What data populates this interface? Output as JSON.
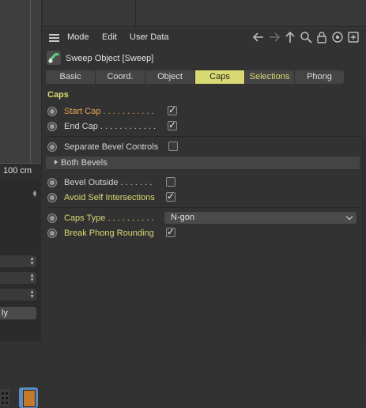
{
  "viewport": {
    "scale_label": "100 cm"
  },
  "left_panel": {
    "apply_button_text": "ly"
  },
  "menubar": {
    "items": [
      "Mode",
      "Edit",
      "User Data"
    ]
  },
  "object": {
    "title": "Sweep Object [Sweep]"
  },
  "tabs": [
    {
      "label": "Basic",
      "active": false
    },
    {
      "label": "Coord.",
      "active": false
    },
    {
      "label": "Object",
      "active": false
    },
    {
      "label": "Caps",
      "active": true
    },
    {
      "label": "Selections",
      "active": false
    },
    {
      "label": "Phong",
      "active": false
    }
  ],
  "section": {
    "title": "Caps"
  },
  "params": {
    "start_cap": {
      "label": "Start Cap . . . . . . . . . . .",
      "checked": true
    },
    "end_cap": {
      "label": "End Cap . . . . . . . . . . . .",
      "checked": true
    },
    "separate_bevel": {
      "label": "Separate Bevel Controls",
      "checked": false
    },
    "both_bevels": {
      "label": "Both Bevels"
    },
    "bevel_outside": {
      "label": "Bevel Outside . . . . . . .",
      "checked": false
    },
    "avoid_self": {
      "label": "Avoid Self Intersections",
      "checked": true
    },
    "caps_type": {
      "label": "Caps Type . . . . . . . . . .",
      "value": "N-gon"
    },
    "break_phong": {
      "label": "Break Phong Rounding",
      "checked": true
    }
  },
  "colors": {
    "accent": "#d9d974",
    "highlight": "#e8a453",
    "background": "#323232"
  }
}
